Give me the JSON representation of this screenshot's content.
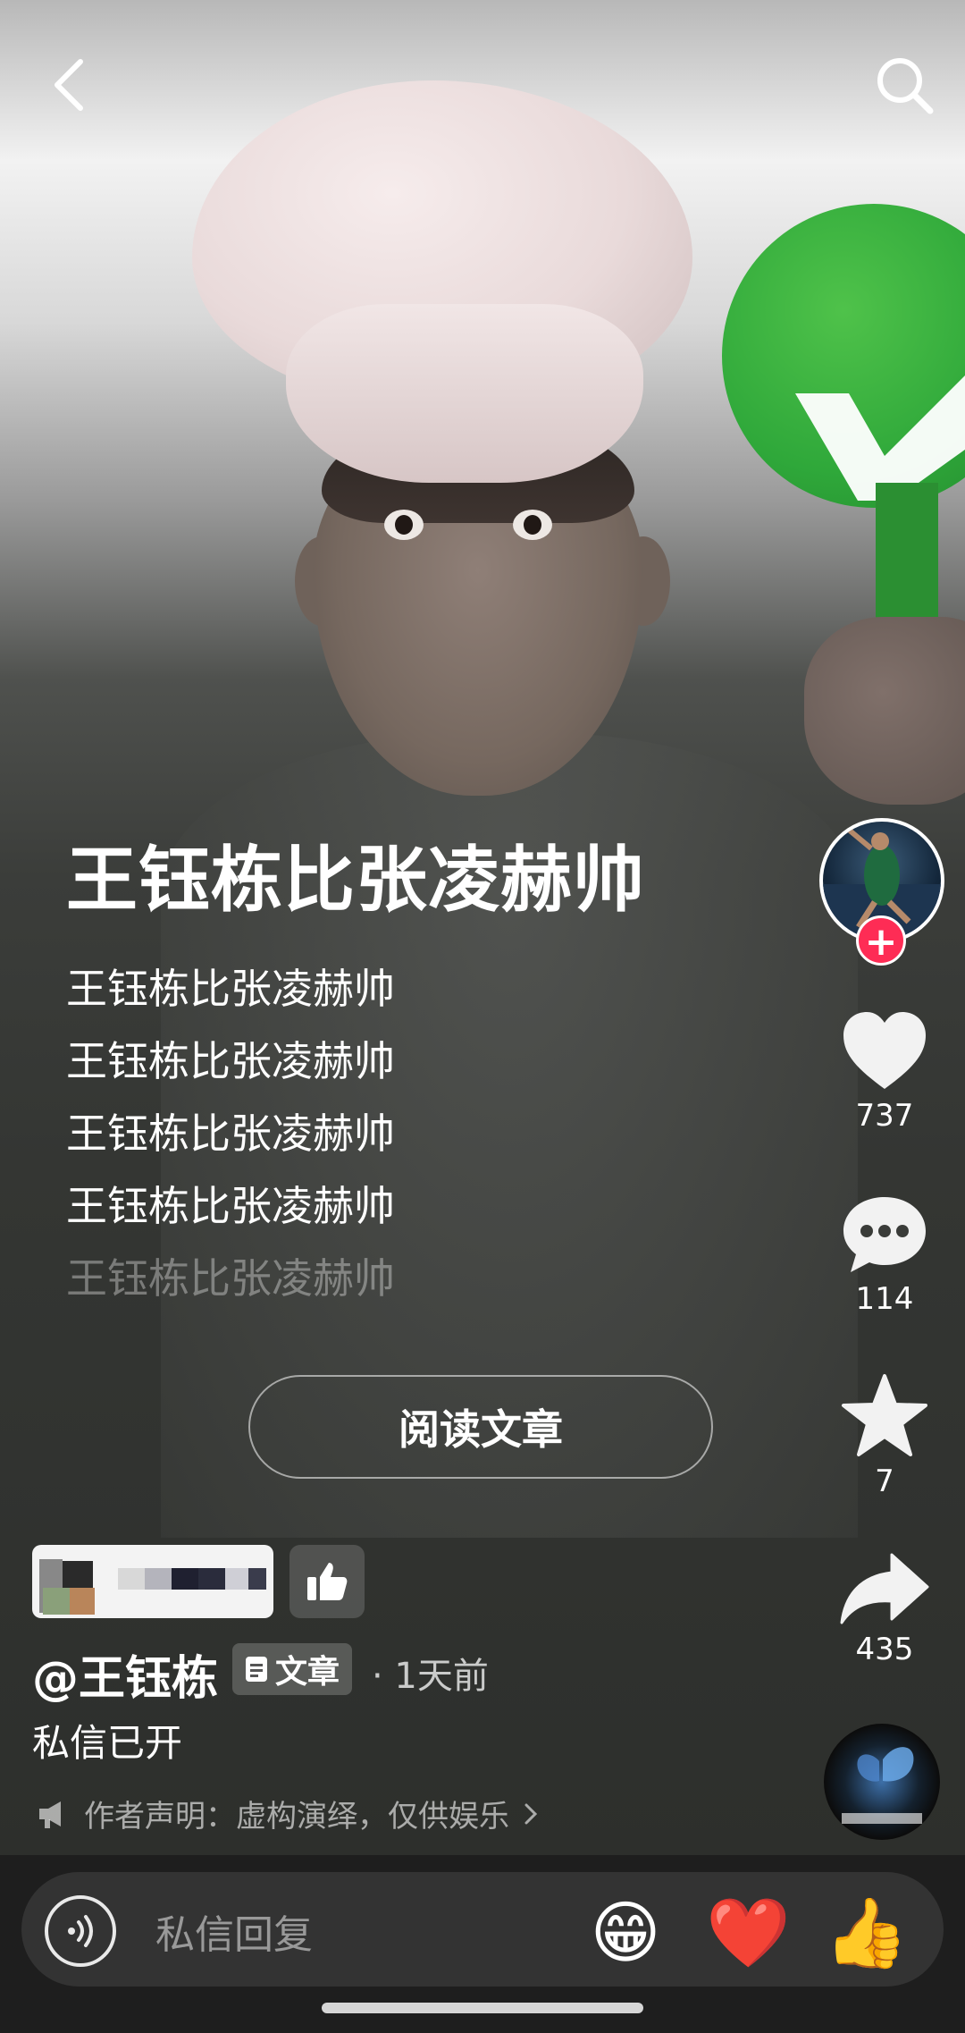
{
  "top_bar": {
    "back_icon": "chevron-left-icon",
    "search_icon": "search-icon"
  },
  "post": {
    "title": "王钰栋比张凌赫帅",
    "lines": [
      "王钰栋比张凌赫帅",
      "王钰栋比张凌赫帅",
      "王钰栋比张凌赫帅",
      "王钰栋比张凌赫帅",
      "王钰栋比张凌赫帅"
    ],
    "read_button": "阅读文章"
  },
  "rail": {
    "follow_plus": "+",
    "likes": "737",
    "comments": "114",
    "favorites": "7",
    "shares": "435"
  },
  "info": {
    "author": "@王钰栋",
    "type_badge": "文章",
    "time": "· 1天前",
    "description": "私信已开",
    "disclaimer": "作者声明：虚构演绎，仅供娱乐"
  },
  "reply": {
    "placeholder": "私信回复",
    "emojis": [
      "😁",
      "❤️",
      "👍"
    ]
  },
  "colors": {
    "accent": "#fe2c55",
    "background": "#1e1e1e",
    "sign_green": "#2fa83a"
  }
}
